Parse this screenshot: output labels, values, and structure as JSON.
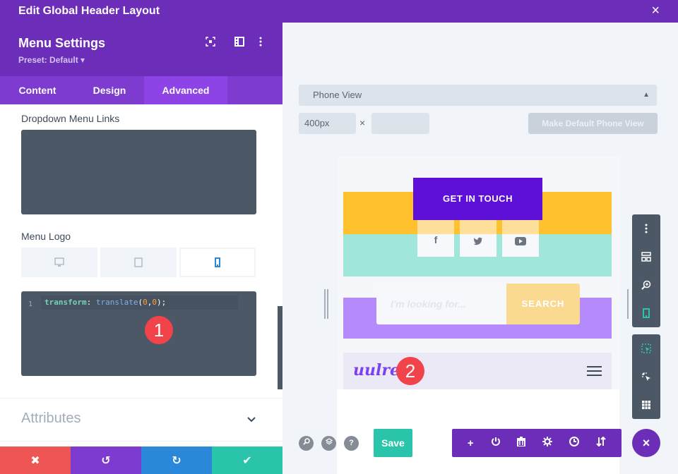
{
  "topbar": {
    "title": "Edit Global Header Layout",
    "close_icon": "×"
  },
  "panel": {
    "title": "Menu Settings",
    "preset": "Preset: Default ▾",
    "tabs": [
      {
        "label": "Content"
      },
      {
        "label": "Design"
      },
      {
        "label": "Advanced",
        "active": true
      }
    ],
    "sections": {
      "dropdown_menu_links": "Dropdown Menu Links",
      "menu_logo": "Menu Logo",
      "device_tabs": [
        "desktop",
        "tablet",
        "phone"
      ],
      "active_device": "phone"
    },
    "code": {
      "line_number": "1",
      "property": "transform",
      "colon": ": ",
      "func": "translate",
      "open": "(",
      "arg1": "0",
      "comma": ",",
      "arg2": "0",
      "close": ");"
    },
    "attributes_label": "Attributes",
    "chevron": "⌄",
    "footer": {
      "cancel": "✖",
      "undo": "↺",
      "redo": "↻",
      "save": "✔"
    }
  },
  "badges": {
    "one": "1",
    "two": "2"
  },
  "preview": {
    "view_select": "Phone View",
    "width_value": "400px",
    "height_value": "",
    "times": "×",
    "make_default": "Make Default Phone View",
    "cta": "GET IN TOUCH",
    "social": [
      "f",
      "🐦",
      "▶"
    ],
    "search_placeholder": "I'm looking for...",
    "search_button": "SEARCH",
    "logo": "uulre"
  },
  "bottom": {
    "save": "Save",
    "tools": [
      "+",
      "⏻",
      "🗑",
      "⚙",
      "🕒",
      "⇅"
    ],
    "close": "×",
    "help": "?"
  },
  "colors": {
    "primary": "#6c2eb9",
    "tab_active": "#8e43e7",
    "cta": "#5e0fd8",
    "save": "#29c4a9",
    "danger": "#ef5555",
    "redo": "#2b87da"
  }
}
